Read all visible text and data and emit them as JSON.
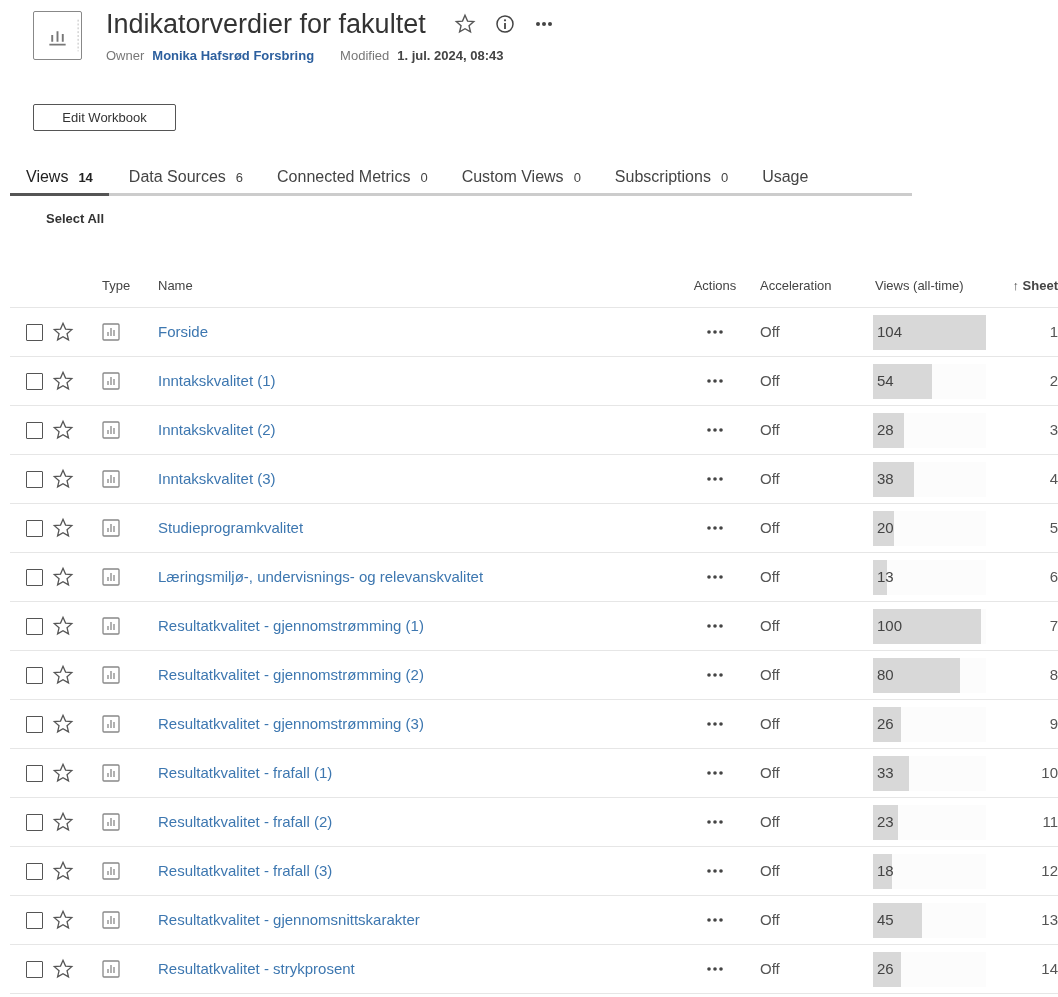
{
  "workbook": {
    "title": "Indikatorverdier for fakultet",
    "owner_label": "Owner",
    "owner": "Monika Hafsrød Forsbring",
    "modified_label": "Modified",
    "modified": "1. jul. 2024, 08:43",
    "favorite": false
  },
  "edit_button": "Edit Workbook",
  "tabs": [
    {
      "label": "Views",
      "count": "14",
      "selected": true
    },
    {
      "label": "Data Sources",
      "count": "6",
      "selected": false
    },
    {
      "label": "Connected Metrics",
      "count": "0",
      "selected": false
    },
    {
      "label": "Custom Views",
      "count": "0",
      "selected": false
    },
    {
      "label": "Subscriptions",
      "count": "0",
      "selected": false
    },
    {
      "label": "Usage",
      "selected": false
    }
  ],
  "select_all": "Select All",
  "table": {
    "columns": [
      "Type",
      "Name",
      "Actions",
      "Acceleration",
      "Views (all-time)",
      "Sheet"
    ],
    "sort_mark": "↑",
    "rows": [
      {
        "checked": false,
        "favorite": false,
        "name": "Forside",
        "acceleration": "Off",
        "views": "104",
        "level": 1.0,
        "sheet": "1"
      },
      {
        "checked": false,
        "favorite": false,
        "name": "Inntakskvalitet (1)",
        "acceleration": "Off",
        "views": "54",
        "level": 0.52,
        "sheet": "2"
      },
      {
        "checked": false,
        "favorite": false,
        "name": "Inntakskvalitet (2)",
        "acceleration": "Off",
        "views": "28",
        "level": 0.27,
        "sheet": "3"
      },
      {
        "checked": false,
        "favorite": false,
        "name": "Inntakskvalitet (3)",
        "acceleration": "Off",
        "views": "38",
        "level": 0.365,
        "sheet": "4"
      },
      {
        "checked": false,
        "favorite": false,
        "name": "Studieprogramkvalitet",
        "acceleration": "Off",
        "views": "20",
        "level": 0.19,
        "sheet": "5"
      },
      {
        "checked": false,
        "favorite": false,
        "name": "Læringsmiljø-, undervisnings- og relevanskvalitet",
        "acceleration": "Off",
        "views": "13",
        "level": 0.125,
        "sheet": "6"
      },
      {
        "checked": false,
        "favorite": false,
        "name": "Resultatkvalitet - gjennomstrømming (1)",
        "acceleration": "Off",
        "views": "100",
        "level": 0.96,
        "sheet": "7"
      },
      {
        "checked": false,
        "favorite": false,
        "name": "Resultatkvalitet - gjennomstrømming (2)",
        "acceleration": "Off",
        "views": "80",
        "level": 0.77,
        "sheet": "8"
      },
      {
        "checked": false,
        "favorite": false,
        "name": "Resultatkvalitet - gjennomstrømming (3)",
        "acceleration": "Off",
        "views": "26",
        "level": 0.25,
        "sheet": "9"
      },
      {
        "checked": false,
        "favorite": false,
        "name": "Resultatkvalitet - frafall (1)",
        "acceleration": "Off",
        "views": "33",
        "level": 0.32,
        "sheet": "10"
      },
      {
        "checked": false,
        "favorite": false,
        "name": "Resultatkvalitet - frafall (2)",
        "acceleration": "Off",
        "views": "23",
        "level": 0.22,
        "sheet": "11"
      },
      {
        "checked": false,
        "favorite": false,
        "name": "Resultatkvalitet - frafall (3)",
        "acceleration": "Off",
        "views": "18",
        "level": 0.17,
        "sheet": "12"
      },
      {
        "checked": false,
        "favorite": false,
        "name": "Resultatkvalitet - gjennomsnittskarakter",
        "acceleration": "Off",
        "views": "45",
        "level": 0.43,
        "sheet": "13"
      },
      {
        "checked": false,
        "favorite": false,
        "name": "Resultatkvalitet - strykprosent",
        "acceleration": "Off",
        "views": "26",
        "level": 0.25,
        "sheet": "14"
      }
    ]
  }
}
